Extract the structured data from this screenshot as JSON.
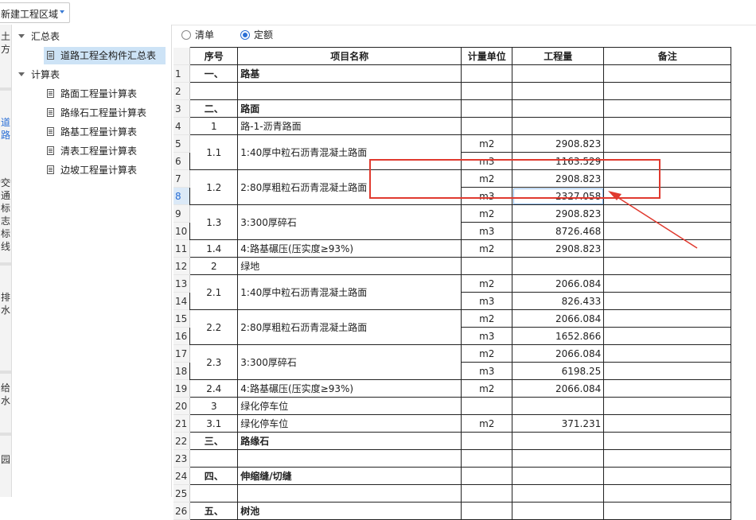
{
  "region_select": {
    "value": "新建工程区域"
  },
  "side_tabs": [
    "土方",
    "道路",
    "交通标志标线",
    "排水",
    "给水",
    "园"
  ],
  "tree": {
    "groups": [
      {
        "label": "汇总表",
        "items": [
          "道路工程全构件汇总表"
        ]
      },
      {
        "label": "计算表",
        "items": [
          "路面工程量计算表",
          "路缘石工程量计算表",
          "路基工程量计算表",
          "清表工程量计算表",
          "边坡工程量计算表"
        ]
      }
    ],
    "selected": "道路工程全构件汇总表"
  },
  "mode": {
    "options": [
      "清单",
      "定额"
    ],
    "selected": "定额"
  },
  "table": {
    "headers": [
      "序号",
      "项目名称",
      "计量单位",
      "工程量",
      "备注"
    ],
    "selected_row": 8,
    "rows": [
      {
        "n": "1",
        "seq": "一、",
        "name": "路基",
        "unit": "",
        "qty": "",
        "bold": true
      },
      {
        "n": "2",
        "seq": "",
        "name": "",
        "unit": "",
        "qty": ""
      },
      {
        "n": "3",
        "seq": "二、",
        "name": "路面",
        "unit": "",
        "qty": "",
        "bold": true
      },
      {
        "n": "4",
        "seq": "1",
        "name": "路-1-沥青路面",
        "unit": "",
        "qty": ""
      },
      {
        "n": "5",
        "seq": "1.1",
        "name": "1:40厚中粒石沥青混凝土路面",
        "unit": "m2",
        "qty": "2908.823"
      },
      {
        "n": "6",
        "seq": "",
        "name": "",
        "unit": "m3",
        "qty": "1163.529"
      },
      {
        "n": "7",
        "seq": "1.2",
        "name": "2:80厚粗粒石沥青混凝土路面",
        "unit": "m2",
        "qty": "2908.823"
      },
      {
        "n": "8",
        "seq": "",
        "name": "",
        "unit": "m3",
        "qty": "2327.058"
      },
      {
        "n": "9",
        "seq": "1.3",
        "name": "3:300厚碎石",
        "unit": "m2",
        "qty": "2908.823"
      },
      {
        "n": "10",
        "seq": "",
        "name": "",
        "unit": "m3",
        "qty": "8726.468"
      },
      {
        "n": "11",
        "seq": "1.4",
        "name": "4:路基碾压(压实度≥93%)",
        "unit": "m2",
        "qty": "2908.823"
      },
      {
        "n": "12",
        "seq": "2",
        "name": "绿地",
        "unit": "",
        "qty": ""
      },
      {
        "n": "13",
        "seq": "2.1",
        "name": "1:40厚中粒石沥青混凝土路面",
        "unit": "m2",
        "qty": "2066.084"
      },
      {
        "n": "14",
        "seq": "",
        "name": "",
        "unit": "m3",
        "qty": "826.433"
      },
      {
        "n": "15",
        "seq": "2.2",
        "name": "2:80厚粗粒石沥青混凝土路面",
        "unit": "m2",
        "qty": "2066.084"
      },
      {
        "n": "16",
        "seq": "",
        "name": "",
        "unit": "m3",
        "qty": "1652.866"
      },
      {
        "n": "17",
        "seq": "2.3",
        "name": "3:300厚碎石",
        "unit": "m2",
        "qty": "2066.084"
      },
      {
        "n": "18",
        "seq": "",
        "name": "",
        "unit": "m3",
        "qty": "6198.25"
      },
      {
        "n": "19",
        "seq": "2.4",
        "name": "4:路基碾压(压实度≥93%)",
        "unit": "m2",
        "qty": "2066.084"
      },
      {
        "n": "20",
        "seq": "3",
        "name": "绿化停车位",
        "unit": "",
        "qty": ""
      },
      {
        "n": "21",
        "seq": "3.1",
        "name": "绿化停车位",
        "unit": "m2",
        "qty": "371.231"
      },
      {
        "n": "22",
        "seq": "三、",
        "name": "路缘石",
        "unit": "",
        "qty": "",
        "bold": true
      },
      {
        "n": "23",
        "seq": "",
        "name": "",
        "unit": "",
        "qty": ""
      },
      {
        "n": "24",
        "seq": "四、",
        "name": "伸缩缝/切缝",
        "unit": "",
        "qty": "",
        "bold": true
      },
      {
        "n": "25",
        "seq": "",
        "name": "",
        "unit": "",
        "qty": ""
      },
      {
        "n": "26",
        "seq": "五、",
        "name": "树池",
        "unit": "",
        "qty": "",
        "bold": true
      }
    ]
  },
  "colors": {
    "annotation": "#e03a2f",
    "accent": "#2a6fd6",
    "selection": "#cde3f6"
  }
}
